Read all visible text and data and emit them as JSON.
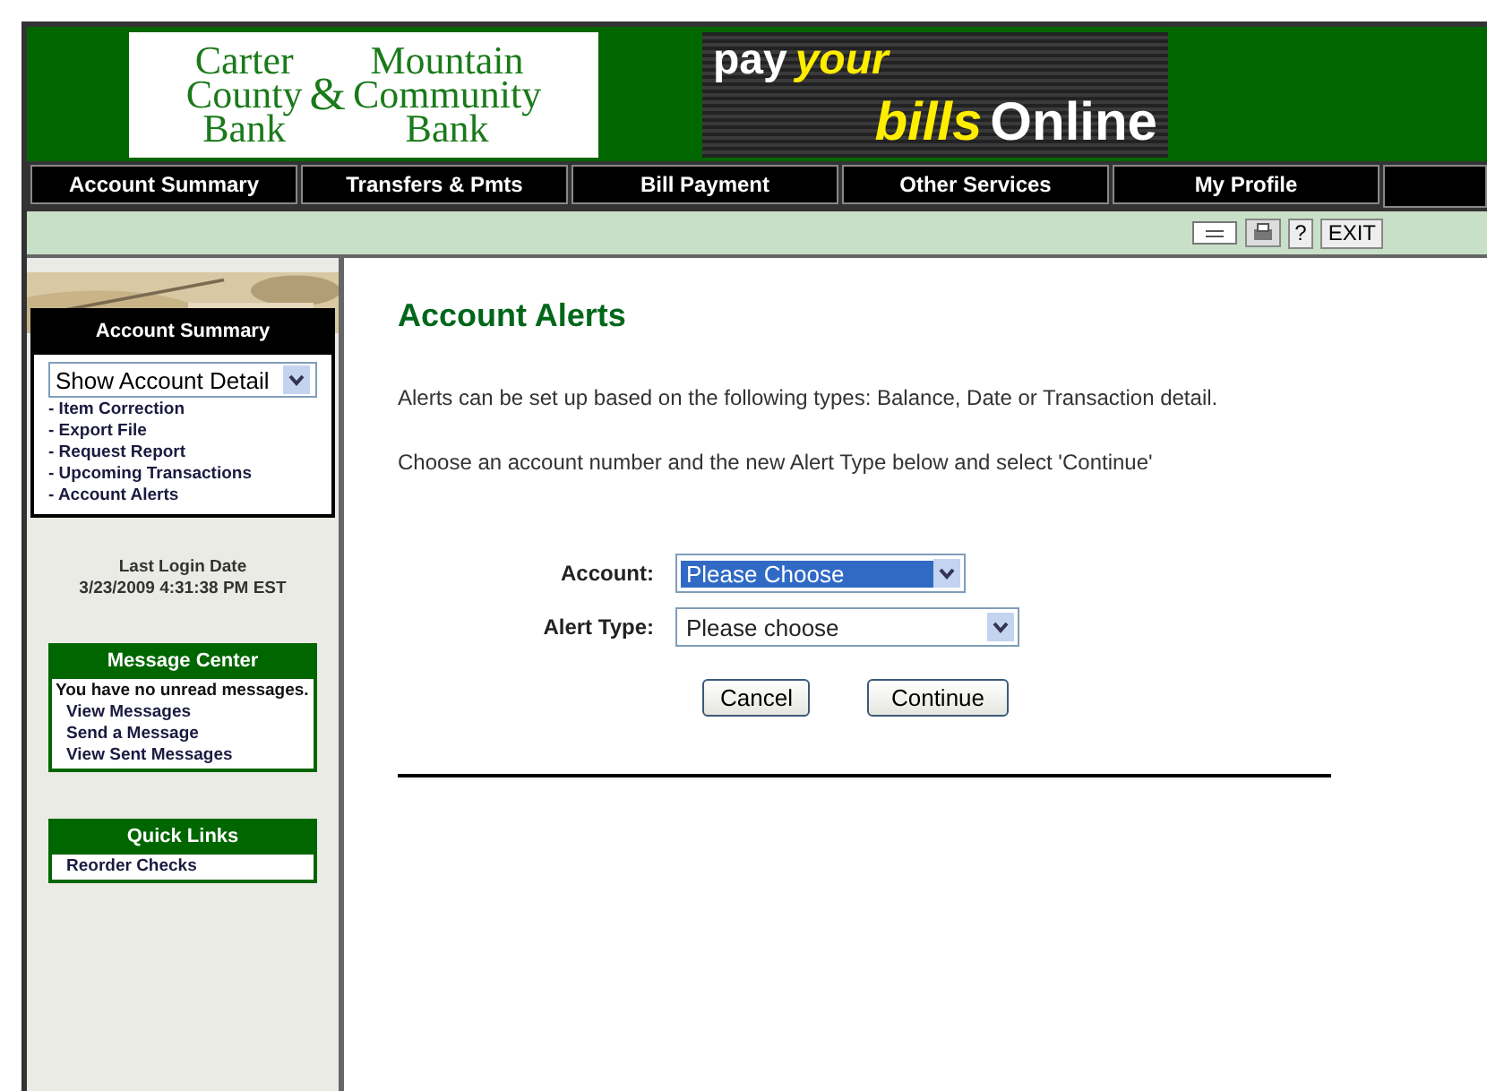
{
  "logo": {
    "left": [
      "Carter",
      "County",
      "Bank"
    ],
    "amp": "&",
    "right": [
      "Mountain",
      "Community",
      "Bank"
    ]
  },
  "promo": {
    "line1": "pay",
    "accent1": "your",
    "accent2": "bills",
    "line2": "Online"
  },
  "nav": [
    {
      "label": "Account Summary"
    },
    {
      "label": "Transfers & Pmts"
    },
    {
      "label": "Bill Payment"
    },
    {
      "label": "Other Services"
    },
    {
      "label": "My Profile"
    }
  ],
  "toolbar": {
    "help": "?",
    "exit": "EXIT"
  },
  "sidebar": {
    "summary": {
      "title": "Account Summary",
      "select": "Show Account Detail",
      "links": [
        "- Item Correction",
        "- Export File",
        "- Request Report",
        "- Upcoming Transactions",
        "- Account Alerts"
      ]
    },
    "last_login": {
      "label": "Last Login Date",
      "value": "3/23/2009 4:31:38 PM EST"
    },
    "message_center": {
      "title": "Message Center",
      "text": "You have no unread messages.",
      "links": [
        "View Messages",
        "Send a Message",
        "View Sent Messages"
      ]
    },
    "quick_links": {
      "title": "Quick Links",
      "links": [
        "Reorder Checks"
      ]
    }
  },
  "main": {
    "title": "Account Alerts",
    "paragraphs": [
      "Alerts can be set up based on the following types: Balance, Date or Transaction detail.",
      "Choose an account number and the new Alert Type below and select 'Continue'"
    ],
    "fields": [
      {
        "label": "Account:",
        "value": "Please Choose",
        "highlighted": true
      },
      {
        "label": "Alert Type:",
        "value": "Please choose",
        "highlighted": false
      }
    ],
    "buttons": [
      "Cancel",
      "Continue"
    ]
  }
}
